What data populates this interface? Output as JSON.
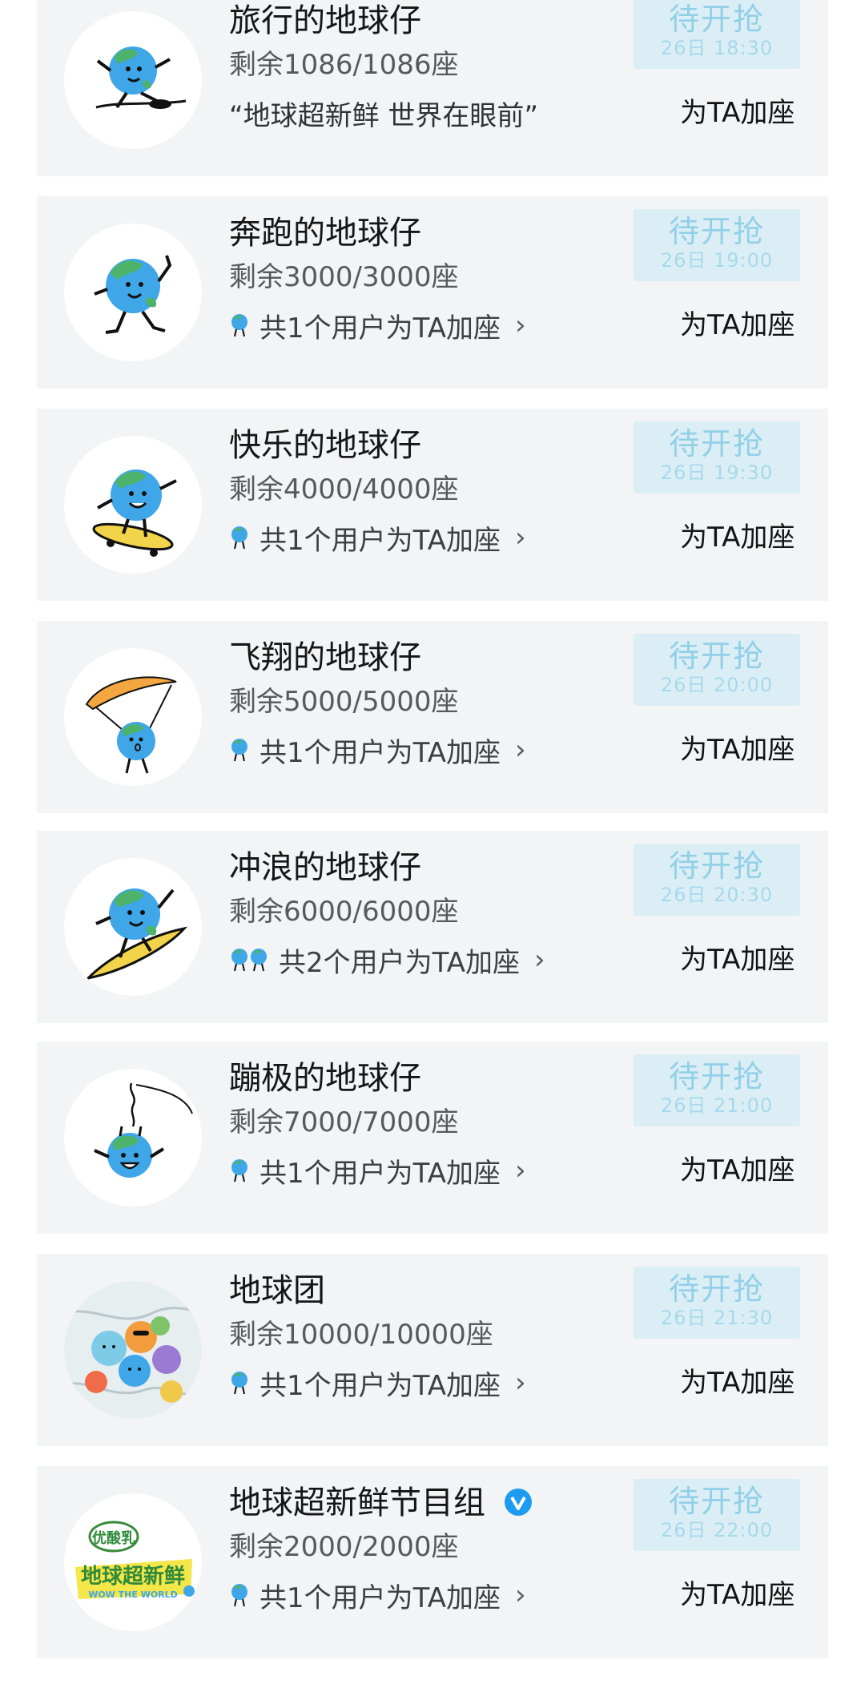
{
  "cards": [
    {
      "title": "旅行的地球仔",
      "seats": "剩余1086/1086座",
      "quote": "“地球超新鲜 世界在眼前”",
      "button": {
        "label": "待开抢",
        "time": "26日 18:30"
      },
      "action": "为TA加座",
      "avatar": "earth-walking-icon"
    },
    {
      "title": "奔跑的地球仔",
      "seats": "剩余3000/3000座",
      "users_text": "共1个用户为TA加座",
      "button": {
        "label": "待开抢",
        "time": "26日 19:00"
      },
      "action": "为TA加座",
      "avatar": "earth-running-icon"
    },
    {
      "title": "快乐的地球仔",
      "seats": "剩余4000/4000座",
      "users_text": "共1个用户为TA加座",
      "button": {
        "label": "待开抢",
        "time": "26日 19:30"
      },
      "action": "为TA加座",
      "avatar": "earth-skateboard-icon"
    },
    {
      "title": "飞翔的地球仔",
      "seats": "剩余5000/5000座",
      "users_text": "共1个用户为TA加座",
      "button": {
        "label": "待开抢",
        "time": "26日 20:00"
      },
      "action": "为TA加座",
      "avatar": "earth-paraglider-icon"
    },
    {
      "title": "冲浪的地球仔",
      "seats": "剩余6000/6000座",
      "users_text": "共2个用户为TA加座",
      "button": {
        "label": "待开抢",
        "time": "26日 20:30"
      },
      "action": "为TA加座",
      "avatar": "earth-surfing-icon"
    },
    {
      "title": "蹦极的地球仔",
      "seats": "剩余7000/7000座",
      "users_text": "共1个用户为TA加座",
      "button": {
        "label": "待开抢",
        "time": "26日 21:00"
      },
      "action": "为TA加座",
      "avatar": "earth-bungee-icon"
    },
    {
      "title": "地球团",
      "seats": "剩余10000/10000座",
      "users_text": "共1个用户为TA加座",
      "button": {
        "label": "待开抢",
        "time": "26日 21:30"
      },
      "action": "为TA加座",
      "avatar": "earth-group-icon"
    },
    {
      "title": "地球超新鲜节目组",
      "seats": "剩余2000/2000座",
      "users_text": "共1个用户为TA加座",
      "button": {
        "label": "待开抢",
        "time": "26日 22:00"
      },
      "action": "为TA加座",
      "avatar": "show-logo-icon",
      "logo_text": {
        "top": "优酸乳",
        "middle": "地球超新鲜",
        "bottom": "WOW THE WORLD"
      }
    }
  ],
  "colors": {
    "card_bg": "#f3f4f5",
    "button_bg": "#dceef5",
    "button_text": "#92d0e8",
    "earth_blue": "#3fa6e8",
    "earth_green": "#4db36a",
    "verified_blue": "#1d9bf0"
  }
}
